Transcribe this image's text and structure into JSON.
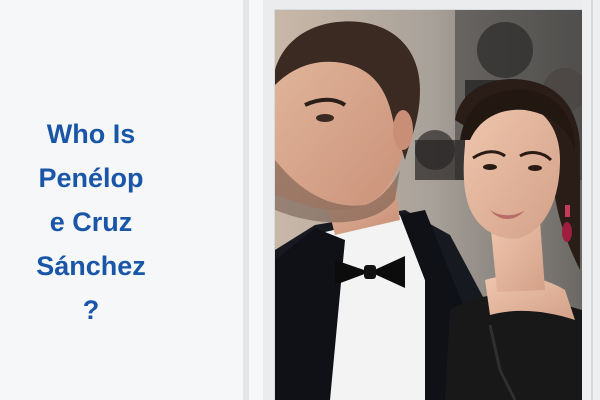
{
  "article": {
    "title_lines": [
      "Who Is",
      "Penélop",
      "e Cruz",
      "Sánchez",
      "?"
    ]
  },
  "photo": {
    "alt": "Two people at a red-carpet event"
  },
  "colors": {
    "title": "#1a56a8",
    "background": "#f6f7f8"
  }
}
